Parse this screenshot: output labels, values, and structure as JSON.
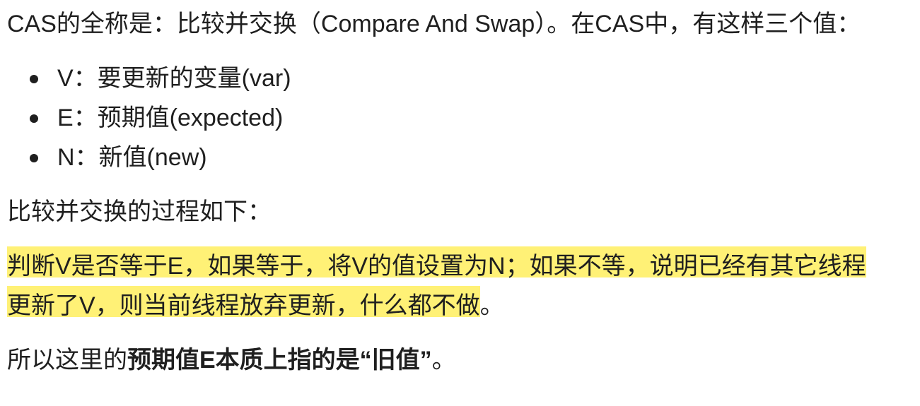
{
  "intro": "CAS的全称是：比较并交换（Compare And Swap）。在CAS中，有这样三个值：",
  "values": [
    {
      "text": "V：要更新的变量(var)"
    },
    {
      "text": "E：预期值(expected)"
    },
    {
      "text": "N：新值(new)"
    }
  ],
  "process_title": "比较并交换的过程如下：",
  "process_line1": "判断V是否等于E，如果等于，将V的值设置为N；如果不等，说明已经有其它线程",
  "process_line2_highlighted": "更新了V，则当前线程放弃更新，什么都不做",
  "process_line2_tail": "。",
  "conclusion": {
    "prefix": "所以这里的",
    "bold": "预期值E本质上指的是“旧值”",
    "suffix": "。"
  },
  "colors": {
    "highlight": "#fff176",
    "text": "#1f1f1f"
  }
}
